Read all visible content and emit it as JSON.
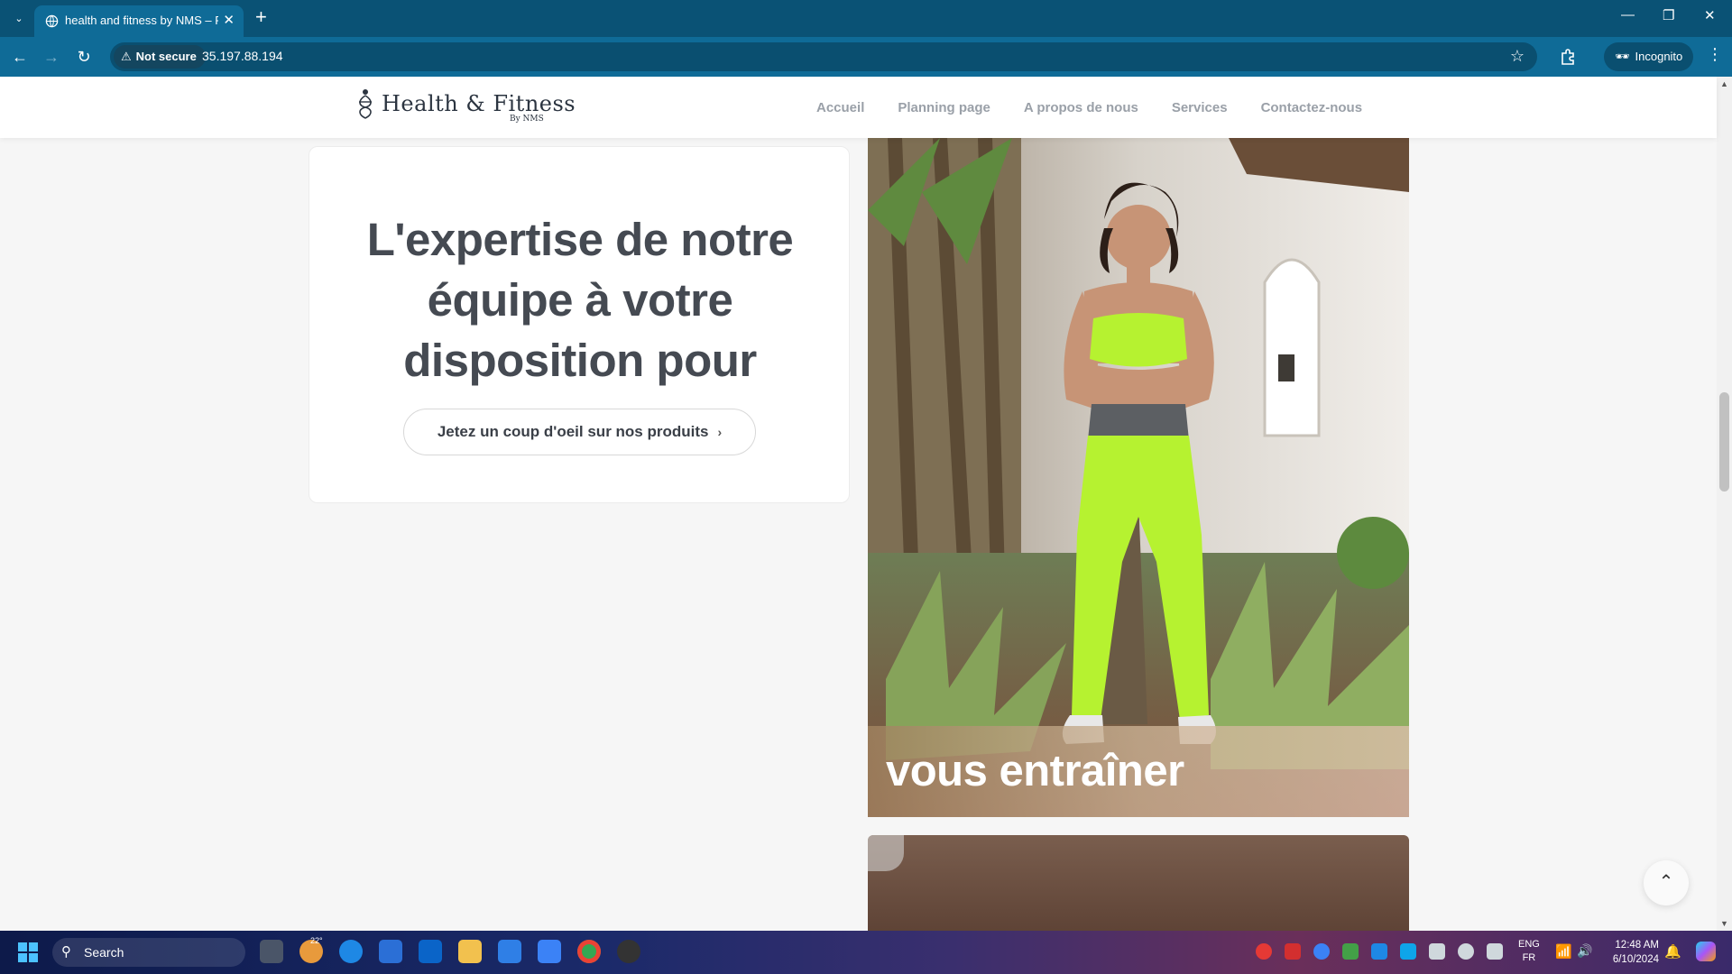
{
  "browser": {
    "tab_title": "health and fitness by NMS – Fi",
    "url_security": "Not secure",
    "url": "35.197.88.194",
    "incognito_label": "Incognito"
  },
  "site": {
    "logo_text": "Health & Fitness",
    "logo_sub": "By NMS",
    "nav": [
      "Accueil",
      "Planning page",
      "A propos de nous",
      "Services",
      "Contactez-nous"
    ]
  },
  "hero_card": {
    "heading_lines": [
      "L'expertise de notre",
      "équipe à votre",
      "disposition pour"
    ],
    "cta_label": "Jetez un coup d'oeil sur nos produits"
  },
  "photo_card": {
    "caption": "vous entraîner"
  },
  "taskbar": {
    "search_placeholder": "Search",
    "weather_temp": "22°",
    "lang_primary": "ENG",
    "lang_secondary": "FR",
    "time": "12:48 AM",
    "date": "6/10/2024"
  },
  "colors": {
    "tabbar": "#0a5275",
    "toolbar": "#0f6b97",
    "heading_text": "#454a52",
    "nav_text": "#9aa0a8",
    "outfit_green": "#b6f230"
  }
}
